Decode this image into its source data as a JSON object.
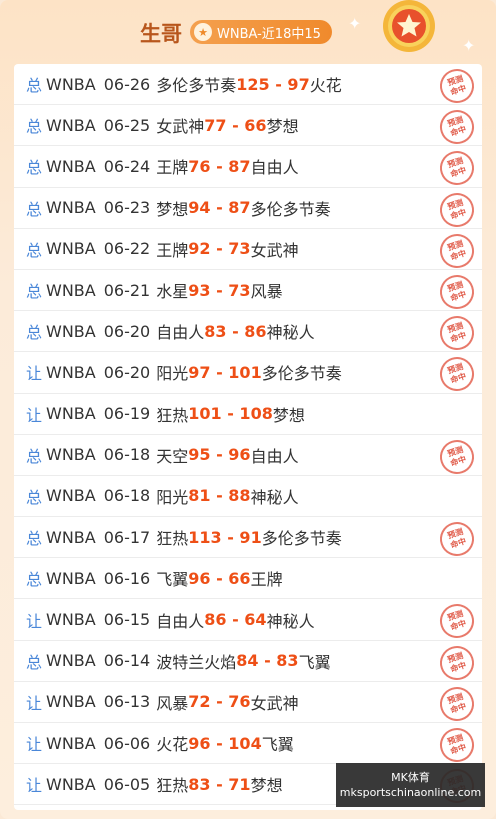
{
  "header": {
    "title": "生哥",
    "badge_icon": "star-icon",
    "badge_text": "WNBA-近18中15"
  },
  "rows": [
    {
      "type": "总",
      "league": "WNBA",
      "date": "06-26",
      "home": "多伦多节奏",
      "score": "125 - 97",
      "away": "火花",
      "hit": true
    },
    {
      "type": "总",
      "league": "WNBA",
      "date": "06-25",
      "home": "女武神",
      "score": "77 - 66",
      "away": "梦想",
      "hit": true
    },
    {
      "type": "总",
      "league": "WNBA",
      "date": "06-24",
      "home": "王牌",
      "score": "76 - 87",
      "away": "自由人",
      "hit": true
    },
    {
      "type": "总",
      "league": "WNBA",
      "date": "06-23",
      "home": "梦想",
      "score": "94 - 87",
      "away": "多伦多节奏",
      "hit": true
    },
    {
      "type": "总",
      "league": "WNBA",
      "date": "06-22",
      "home": "王牌",
      "score": "92 - 73",
      "away": "女武神",
      "hit": true
    },
    {
      "type": "总",
      "league": "WNBA",
      "date": "06-21",
      "home": "水星",
      "score": "93 - 73",
      "away": "风暴",
      "hit": true
    },
    {
      "type": "总",
      "league": "WNBA",
      "date": "06-20",
      "home": "自由人",
      "score": "83 - 86",
      "away": "神秘人",
      "hit": true
    },
    {
      "type": "让",
      "league": "WNBA",
      "date": "06-20",
      "home": "阳光",
      "score": "97 - 101",
      "away": "多伦多节奏",
      "hit": true
    },
    {
      "type": "让",
      "league": "WNBA",
      "date": "06-19",
      "home": "狂热",
      "score": "101 - 108",
      "away": "梦想",
      "hit": false
    },
    {
      "type": "总",
      "league": "WNBA",
      "date": "06-18",
      "home": "天空",
      "score": "95 - 96",
      "away": "自由人",
      "hit": true
    },
    {
      "type": "总",
      "league": "WNBA",
      "date": "06-18",
      "home": "阳光",
      "score": "81 - 88",
      "away": "神秘人",
      "hit": false
    },
    {
      "type": "总",
      "league": "WNBA",
      "date": "06-17",
      "home": "狂热",
      "score": "113 - 91",
      "away": "多伦多节奏",
      "hit": true
    },
    {
      "type": "总",
      "league": "WNBA",
      "date": "06-16",
      "home": "飞翼",
      "score": "96 - 66",
      "away": "王牌",
      "hit": false
    },
    {
      "type": "让",
      "league": "WNBA",
      "date": "06-15",
      "home": "自由人",
      "score": "86 - 64",
      "away": "神秘人",
      "hit": true
    },
    {
      "type": "总",
      "league": "WNBA",
      "date": "06-14",
      "home": "波特兰火焰",
      "score": "84 - 83",
      "away": "飞翼",
      "hit": true
    },
    {
      "type": "让",
      "league": "WNBA",
      "date": "06-13",
      "home": "风暴",
      "score": "72 - 76",
      "away": "女武神",
      "hit": true
    },
    {
      "type": "让",
      "league": "WNBA",
      "date": "06-06",
      "home": "火花",
      "score": "96 - 104",
      "away": "飞翼",
      "hit": true
    },
    {
      "type": "让",
      "league": "WNBA",
      "date": "06-05",
      "home": "狂热",
      "score": "83 - 71",
      "away": "梦想",
      "hit": true
    }
  ],
  "stamp": {
    "line1": "预测",
    "line2": "命中"
  },
  "watermark": {
    "line1": "MK体育",
    "line2": "mksportschinaonline.com"
  },
  "colors": {
    "accent": "#ee4f16",
    "type": "#4a87d8",
    "title": "#b8561c",
    "stamp": "#e05a48"
  }
}
